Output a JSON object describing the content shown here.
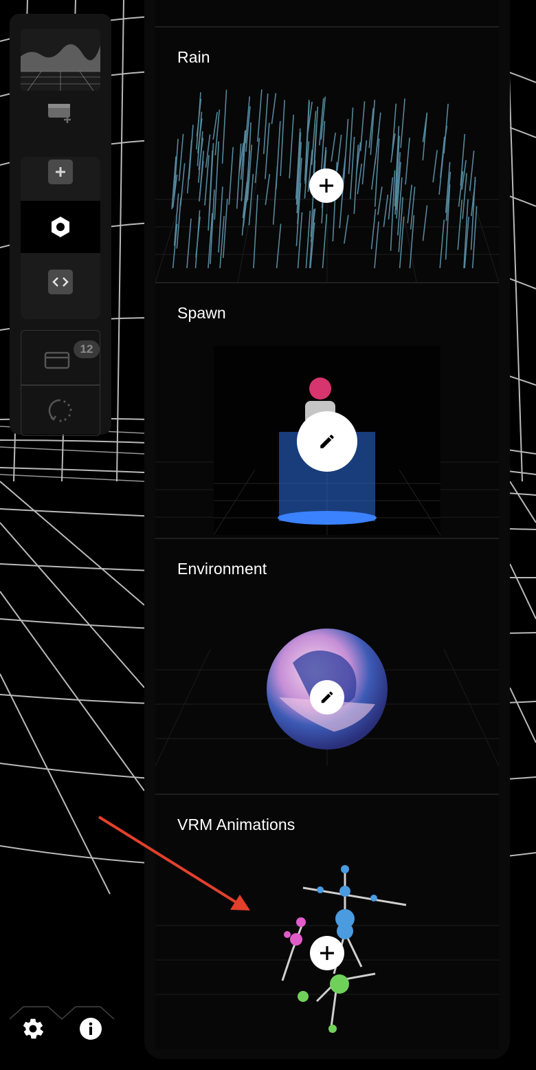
{
  "sidebar": {
    "tools": [
      {
        "name": "add-layout",
        "icon": "panel-plus-icon"
      },
      {
        "name": "add",
        "icon": "plus-icon"
      },
      {
        "name": "settings-hex",
        "icon": "hexagon-icon"
      },
      {
        "name": "code",
        "icon": "code-icon"
      }
    ],
    "cards_badge": "12"
  },
  "panel": {
    "sections": [
      {
        "title": "Rain",
        "action": "add"
      },
      {
        "title": "Spawn",
        "action": "edit"
      },
      {
        "title": "Environment",
        "action": "edit"
      },
      {
        "title": "VRM Animations",
        "action": "add"
      }
    ]
  },
  "footer": {
    "icons": [
      "gear-icon",
      "info-icon"
    ]
  },
  "colors": {
    "accent_arrow": "#e2402c",
    "rain": "#6fb3cf",
    "panel_bg": "#0a0a0a"
  }
}
